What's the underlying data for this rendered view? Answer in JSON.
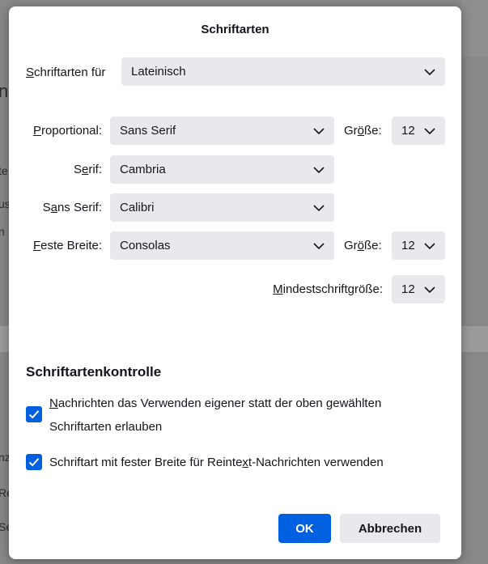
{
  "background": {
    "fragments": [
      "ng",
      "te",
      "us",
      "n",
      "nz",
      "Re",
      "Se"
    ]
  },
  "dialog": {
    "title": "Schriftarten",
    "fonts_for": {
      "label_pre": "",
      "label_key": "S",
      "label_post": "chriftarten für",
      "value": "Lateinisch"
    },
    "proportional": {
      "label_pre": "",
      "label_key": "P",
      "label_post": "roportional:",
      "value": "Sans Serif",
      "size_label_pre": "Gr",
      "size_label_key": "ö",
      "size_label_post": "ße:",
      "size_value": "12"
    },
    "serif": {
      "label_pre": "S",
      "label_key": "e",
      "label_post": "rif:",
      "value": "Cambria"
    },
    "sans_serif": {
      "label_pre": "S",
      "label_key": "a",
      "label_post": "ns Serif:",
      "value": "Calibri"
    },
    "monospace": {
      "label_pre": "",
      "label_key": "F",
      "label_post": "este Breite:",
      "value": "Consolas",
      "size_label_pre": "Gr",
      "size_label_key": "ö",
      "size_label_post": "ße:",
      "size_value": "12"
    },
    "min_size": {
      "label_pre": "",
      "label_key": "M",
      "label_post": "indestschriftgröße:",
      "value": "12"
    },
    "control": {
      "title": "Schriftartenkontrolle",
      "allow_own_fonts": {
        "checked": true,
        "text_pre": "",
        "text_key": "N",
        "text_post": "achrichten das Verwenden eigener statt der oben gewählten Schriftarten erlauben"
      },
      "monospace_plaintext": {
        "checked": true,
        "text_pre": "Schriftart mit fester Breite für Reinte",
        "text_key": "x",
        "text_post": "t-Nachrichten verwenden"
      }
    },
    "buttons": {
      "ok": "OK",
      "cancel": "Abbrechen"
    }
  },
  "colors": {
    "accent": "#0061e0",
    "control_bg": "#e9e9ed",
    "overlay": "#888888"
  }
}
